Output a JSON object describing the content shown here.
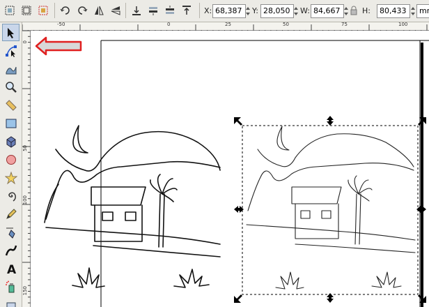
{
  "toolbar": {
    "fields": [
      {
        "label": "X:",
        "value": "68,387"
      },
      {
        "label": "Y:",
        "value": "28,050"
      },
      {
        "label": "W:",
        "value": "84,667"
      },
      {
        "label": "H:",
        "value": "80,433"
      }
    ],
    "unit": "mm",
    "buttons": [
      "select-all-icon",
      "select-all-layers-icon",
      "deselect-icon",
      "rotate-ccw-icon",
      "rotate-cw-icon",
      "flip-horizontal-icon",
      "flip-vertical-icon",
      "lower-to-bottom-icon",
      "lower-icon",
      "raise-icon",
      "raise-to-top-icon",
      "lock-ratio-icon"
    ]
  },
  "tools": [
    "selector-tool-icon",
    "node-tool-icon",
    "tweak-tool-icon",
    "zoom-tool-icon",
    "measure-tool-icon",
    "rectangle-tool-icon",
    "3d-box-tool-icon",
    "ellipse-tool-icon",
    "star-tool-icon",
    "spiral-tool-icon",
    "pencil-tool-icon",
    "pen-tool-icon",
    "calligraphy-tool-icon",
    "text-tool-icon",
    "spray-tool-icon"
  ],
  "ruler": {
    "top_labels": [
      "-50",
      "0",
      "25",
      "50",
      "75",
      "100"
    ],
    "left_labels": [
      "0",
      "50",
      "100",
      "150"
    ]
  },
  "annotation": {
    "arrow_color": "#e02020"
  },
  "colors": {
    "selection_dash": "#000000",
    "page_border": "#000000"
  }
}
